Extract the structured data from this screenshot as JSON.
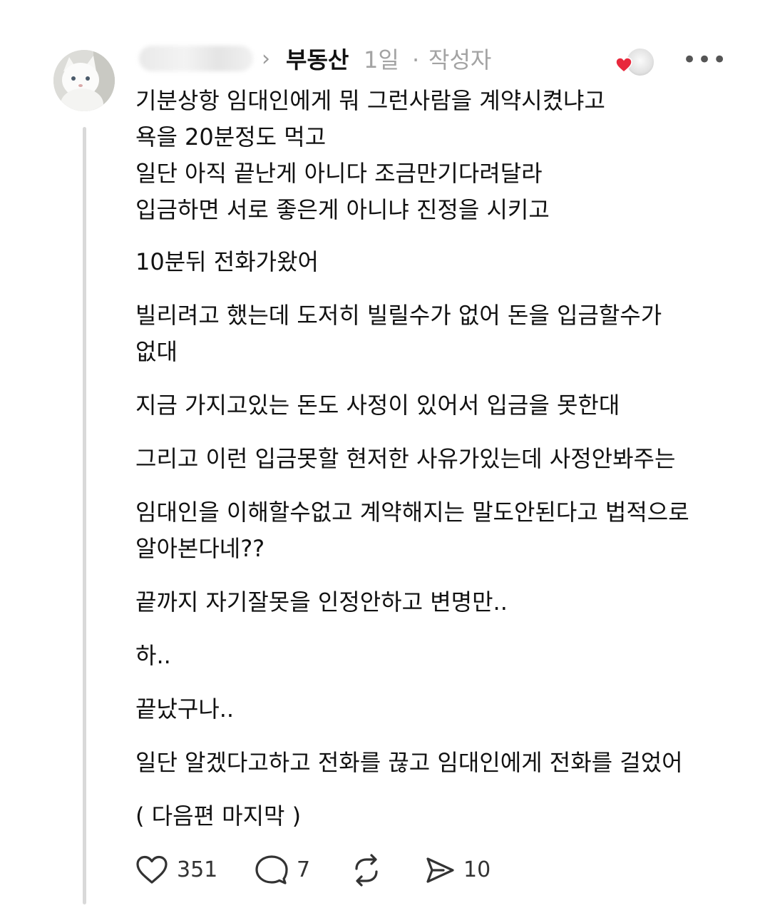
{
  "post": {
    "community": "부동산",
    "time": "1일",
    "separator": "·",
    "author_tag": "작성자",
    "more_label": "•••"
  },
  "body": {
    "paragraphs": [
      [
        "기분상항 임대인에게 뭐 그런사람을 계약시켰냐고",
        "욕을 20분정도 먹고",
        "일단 아직 끝난게 아니다 조금만기다려달라",
        "입금하면 서로 좋은게 아니냐 진정을 시키고"
      ],
      [
        "10분뒤 전화가왔어"
      ],
      [
        "빌리려고 했는데 도저히 빌릴수가 없어 돈을 입금할수가",
        "없대"
      ],
      [
        "지금 가지고있는 돈도 사정이 있어서 입금을 못한대"
      ],
      [
        "그리고 이런 입금못할 현저한 사유가있는데 사정안봐주는"
      ],
      [
        "임대인을 이해할수없고 계약해지는 말도안된다고 법적으로",
        "알아본다네??"
      ],
      [
        "끝까지 자기잘못을 인정안하고 변명만.."
      ],
      [
        "하.."
      ],
      [
        "끝났구나.."
      ],
      [
        "일단 알겠다고하고 전화를 끊고 임대인에게 전화를 걸었어"
      ],
      [
        "( 다음편 마지막 )"
      ]
    ]
  },
  "actions": {
    "likes": "351",
    "comments": "7",
    "reposts": "",
    "shares": "10"
  },
  "icons": {
    "like": "heart-icon",
    "comment": "comment-bubble-icon",
    "repost": "repost-icon",
    "share": "send-icon",
    "chevron": "chevron-right-icon",
    "more": "more-horizontal-icon"
  },
  "colors": {
    "text": "#111111",
    "muted": "#a3a3a3",
    "thread_line": "#d9d9d9",
    "heart_badge": "#e8283c"
  }
}
